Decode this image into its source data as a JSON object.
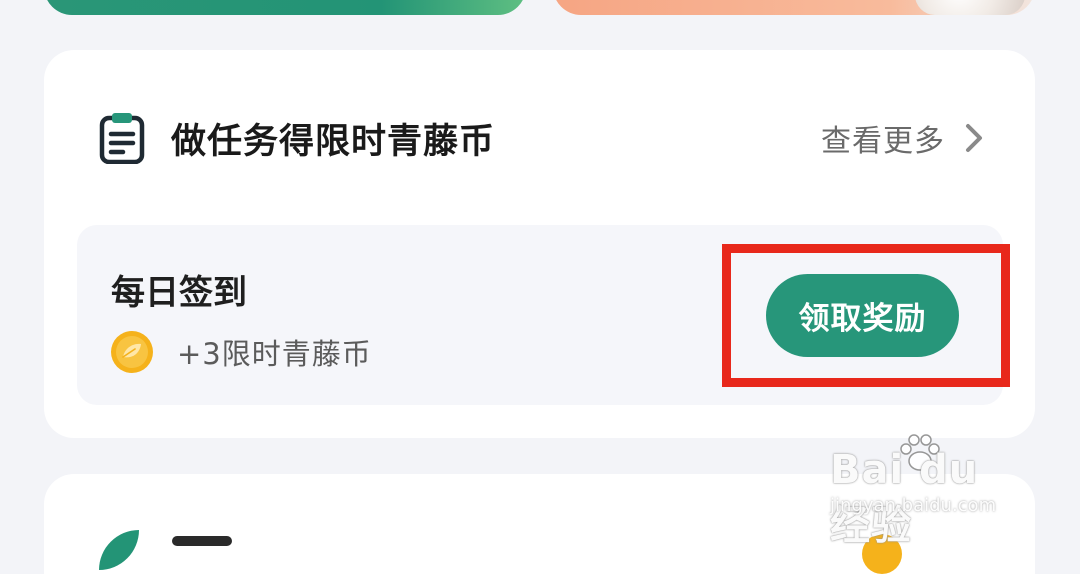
{
  "section": {
    "title": "做任务得限时青藤币",
    "more_label": "查看更多"
  },
  "task": {
    "name": "每日签到",
    "reward": "+3限时青藤币",
    "button_label": "领取奖励"
  },
  "watermark": {
    "brand": "Bai du 经验",
    "url": "jingyan.baidu.com"
  },
  "icons": {
    "header": "clipboard-icon",
    "more": "chevron-right-icon",
    "coin": "leaf-coin-icon"
  },
  "colors": {
    "accent": "#27967a",
    "highlight": "#e8281b",
    "coin": "#f5b21b"
  }
}
